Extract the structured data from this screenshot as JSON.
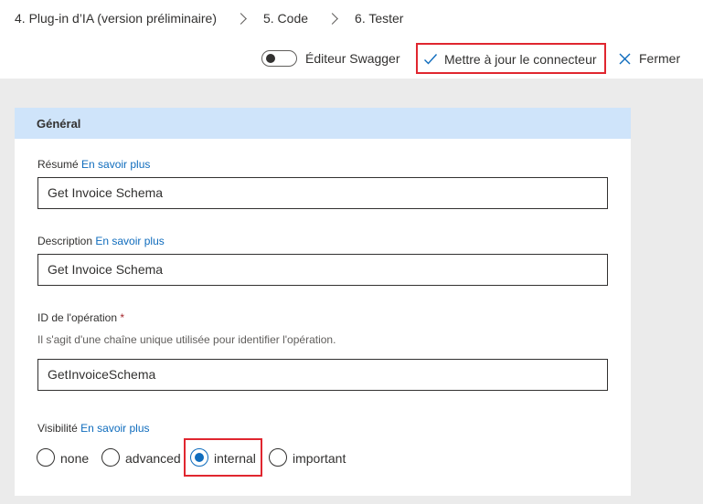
{
  "breadcrumb": {
    "step4": "4. Plug-in d’IA (version préliminaire)",
    "step5": "5. Code",
    "step6": "6. Tester"
  },
  "toolbar": {
    "swagger_toggle_label": "Éditeur Swagger",
    "swagger_toggle_on": false,
    "update_label": "Mettre à jour le connecteur",
    "close_label": "Fermer"
  },
  "section": {
    "title": "Général",
    "summary": {
      "label": "Résumé",
      "link": "En savoir plus",
      "value": "Get Invoice Schema"
    },
    "description": {
      "label": "Description",
      "link": "En savoir plus",
      "value": "Get Invoice Schema"
    },
    "operation_id": {
      "label": "ID de l'opération",
      "required_mark": "*",
      "hint": "Il s'agit d'une chaîne unique utilisée pour identifier l'opération.",
      "value": "GetInvoiceSchema"
    },
    "visibility": {
      "label": "Visibilité",
      "link": "En savoir plus",
      "options": [
        "none",
        "advanced",
        "internal",
        "important"
      ],
      "selected": "internal"
    }
  },
  "colors": {
    "accent": "#0f6cbd",
    "highlight": "#e0262f",
    "header_bg": "#cfe4fa",
    "background": "#ebebeb"
  }
}
